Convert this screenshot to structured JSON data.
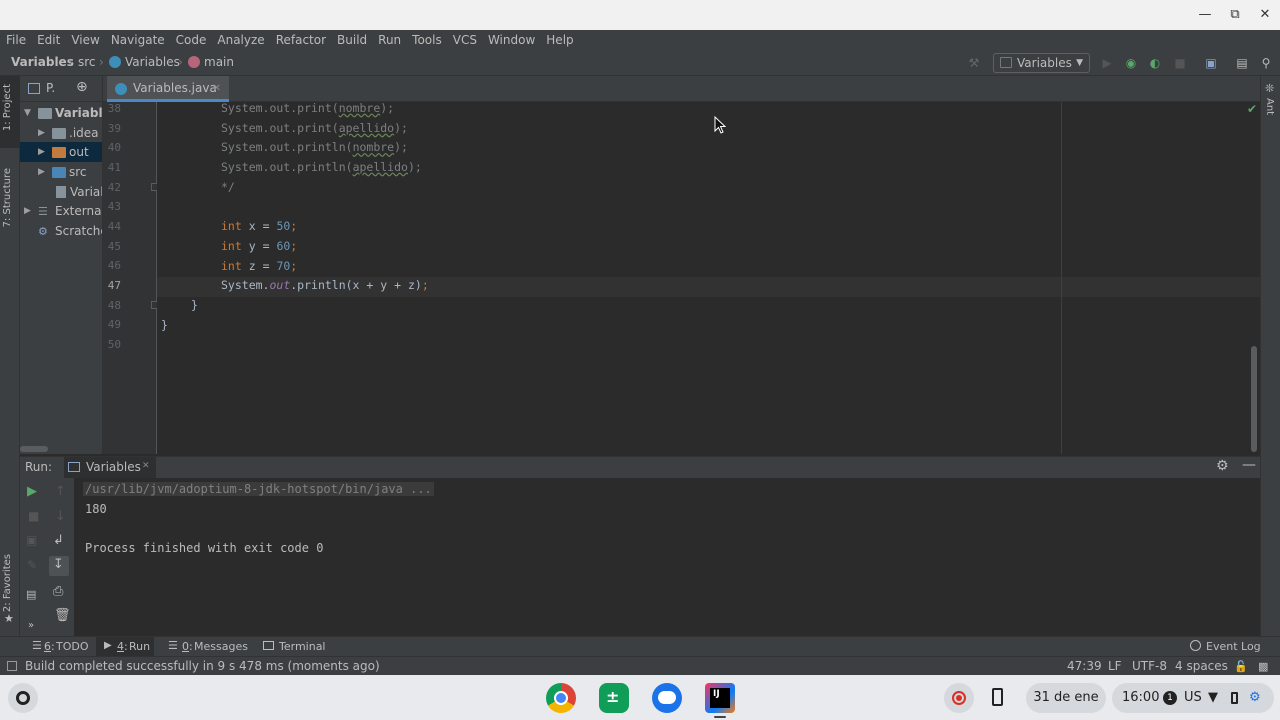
{
  "menu": [
    "File",
    "Edit",
    "View",
    "Navigate",
    "Code",
    "Analyze",
    "Refactor",
    "Build",
    "Run",
    "Tools",
    "VCS",
    "Window",
    "Help"
  ],
  "breadcrumb": {
    "project": "Variables",
    "folder": "src",
    "class": "Variables",
    "method": "main"
  },
  "run_config": "Variables",
  "project_panel": {
    "title": "P.",
    "items": [
      {
        "label": "Variable"
      },
      {
        "label": ".idea"
      },
      {
        "label": "out"
      },
      {
        "label": "src"
      },
      {
        "label": "Varial"
      },
      {
        "label": "External"
      },
      {
        "label": "Scratche"
      }
    ]
  },
  "left_strip": {
    "project": "1: Project",
    "structure": "7: Structure",
    "favorites": "2: Favorites"
  },
  "right_strip": {
    "ant": "Ant"
  },
  "editor": {
    "tab": "Variables.java",
    "line_numbers": [
      "38",
      "39",
      "40",
      "41",
      "42",
      "43",
      "44",
      "45",
      "46",
      "47",
      "48",
      "49",
      "50"
    ],
    "code": {
      "l38_obj": "System.out.print(",
      "l38_arg": "nombre",
      "l38_end": ");",
      "l39_obj": "System.out.print(",
      "l39_arg": "apellido",
      "l39_end": ");",
      "l40_obj": "System.out.println(",
      "l40_arg": "nombre",
      "l40_end": ");",
      "l41_obj": "System.out.println(",
      "l41_arg": "apellido",
      "l41_end": ");",
      "l42": "*/",
      "kw_int": "int",
      "l44_var": "x",
      "l44_val": "50",
      "l45_var": "y",
      "l45_val": "60",
      "l46_var": "z",
      "l46_val": "70",
      "l47_a": "System.",
      "l47_field": "out",
      "l47_b": ".println(x + y + z)",
      "l47_end": ";",
      "l48": "}",
      "l49": "}"
    }
  },
  "run_panel": {
    "label": "Run:",
    "tab": "Variables",
    "console": [
      "/usr/lib/jvm/adoptium-8-jdk-hotspot/bin/java ...",
      "180",
      "",
      "Process finished with exit code 0"
    ]
  },
  "bottom_tabs": [
    {
      "key": "6",
      "label": "TODO"
    },
    {
      "key": "4",
      "label": "Run"
    },
    {
      "key": "0",
      "label": "Messages"
    },
    {
      "key": "",
      "label": "Terminal"
    }
  ],
  "event_log": "Event Log",
  "status": {
    "message": "Build completed successfully in 9 s 478 ms (moments ago)",
    "position": "47:39",
    "line_sep": "LF",
    "encoding": "UTF-8",
    "indent": "4 spaces"
  },
  "shelf": {
    "date": "31 de ene",
    "time": "16:00",
    "notifications": "1",
    "keyboard": "US"
  }
}
